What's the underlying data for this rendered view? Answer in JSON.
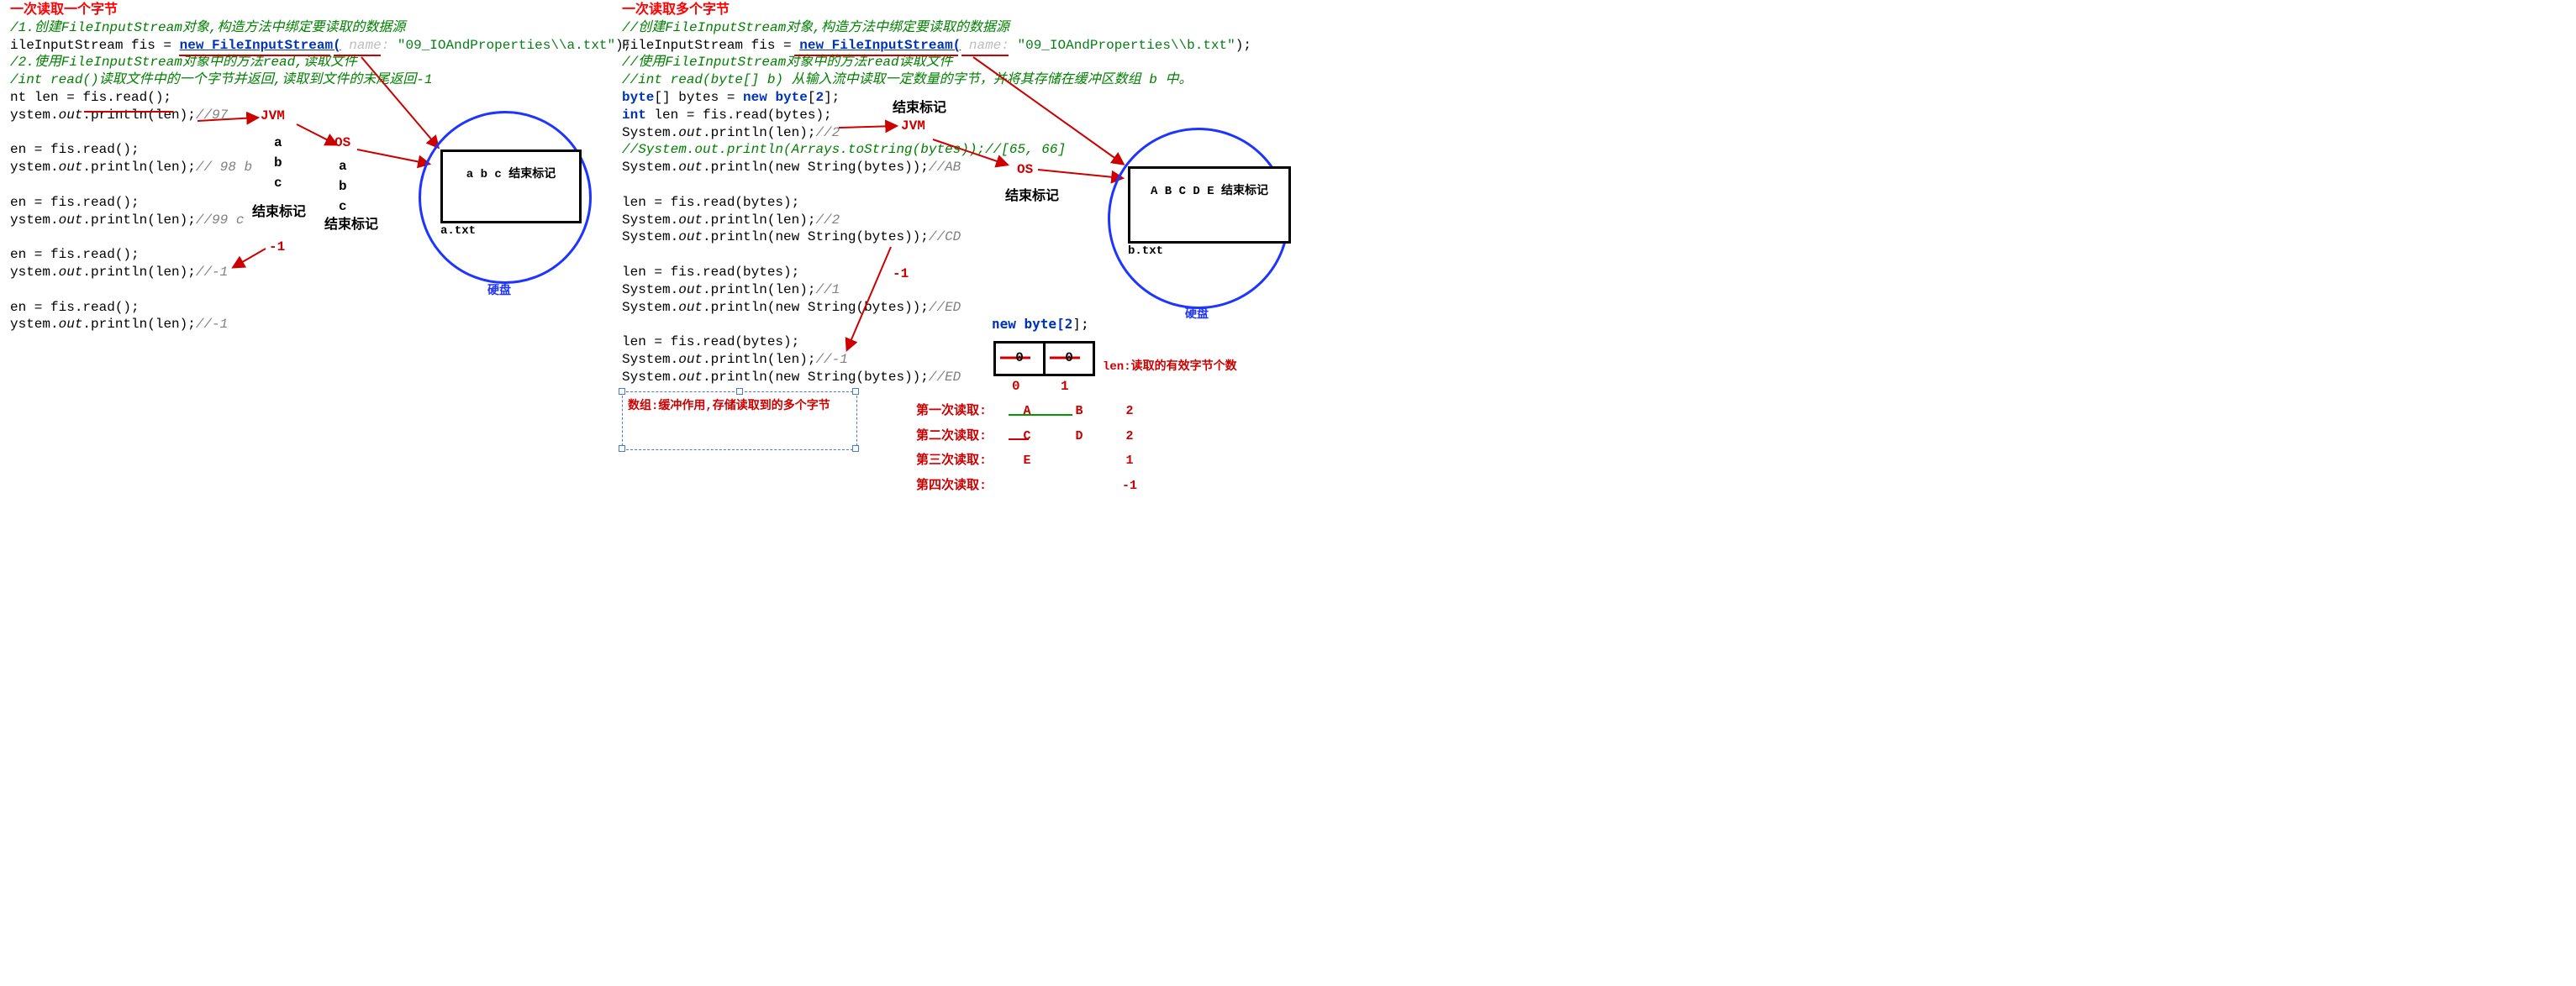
{
  "left": {
    "title": "一次读取一个字节",
    "c1": "/1.创建FileInputStream对象,构造方法中绑定要读取的数据源",
    "l2a": "ileInputStream fis = ",
    "l2b": "new FileInputStream(",
    "hint_name": " name: ",
    "l2c": "\"09_IOAndProperties\\\\a.txt\"",
    "l2d": ");",
    "c2": "/2.使用FileInputStream对象中的方法read,读取文件",
    "c3": "/int read()读取文件中的一个字节并返回,读取到文件的末尾返回-1",
    "l4a": "nt len = fis.read();",
    "l5a": "ystem.",
    "out": "out",
    "l5b": ".println(len);",
    "cmt97": "//97 ",
    "l6": "en = fis.read();",
    "cmt98": "// 98 b",
    "cmt99": "//99 c",
    "cmtneg1a": "//-1",
    "cmtneg1b": "//-1",
    "jvm": "JVM",
    "os": "OS",
    "seq_a": "a",
    "seq_b": "b",
    "seq_c": "c",
    "endmark": "结束标记",
    "neg1": "-1",
    "file_content": "a b c 结束标记",
    "file_name": "a.txt",
    "disk": "硬盘"
  },
  "right": {
    "title": "一次读取多个字节",
    "c1": "//创建FileInputStream对象,构造方法中绑定要读取的数据源",
    "l2a": "FileInputStream fis = ",
    "l2b": "new FileInputStream(",
    "hint_name": " name: ",
    "l2c": "\"09_IOAndProperties\\\\b.txt\"",
    "l2d": ");",
    "c2": "//使用FileInputStream对象中的方法read读取文件",
    "c3": "//int read(byte[] b) 从输入流中读取一定数量的字节，并将其存储在缓冲区数组 b 中。",
    "l4": "byte[] bytes = new byte[2];",
    "l5": "int len = fis.read(bytes);",
    "sys": "System.",
    "out": "out",
    "printlen": ".println(len);",
    "cmt2a": "//2",
    "c4": "//System.out.println(Arrays.toString(bytes));//[65, 66]",
    "printstr": ".println(new String(bytes));",
    "cmtAB": "//AB",
    "readcall": "len = fis.read(bytes);",
    "cmt2b": "//2",
    "cmtCD": "//CD",
    "cmt1": "//1",
    "cmtED": "//ED",
    "cmtneg1": "//-1",
    "cmtED2": "//ED",
    "jvm": "JVM",
    "os": "OS",
    "endmark": "结束标记",
    "endmark2": "结束标记",
    "neg1": "-1",
    "file_content": "A B C D E 结束标记",
    "file_name": "b.txt",
    "disk": "硬盘",
    "note": "数组:缓冲作用,存储读取到的多个字节",
    "newbyte": "new byte[",
    "two": "2",
    "bracket": "];",
    "cellzero": "0",
    "cellzero2": "0",
    "idx0": "0",
    "idx1": "1",
    "len_label": "len:读取的有效字节个数",
    "row1l": "第一次读取:",
    "row1a": "A",
    "row1b": "B",
    "row1v": "2",
    "row2l": "第二次读取:",
    "row2a": "C",
    "row2b": "D",
    "row2v": "2",
    "row3l": "第三次读取:",
    "row3a": "E",
    "row3v": "1",
    "row4l": "第四次读取:",
    "row4v": "-1"
  }
}
